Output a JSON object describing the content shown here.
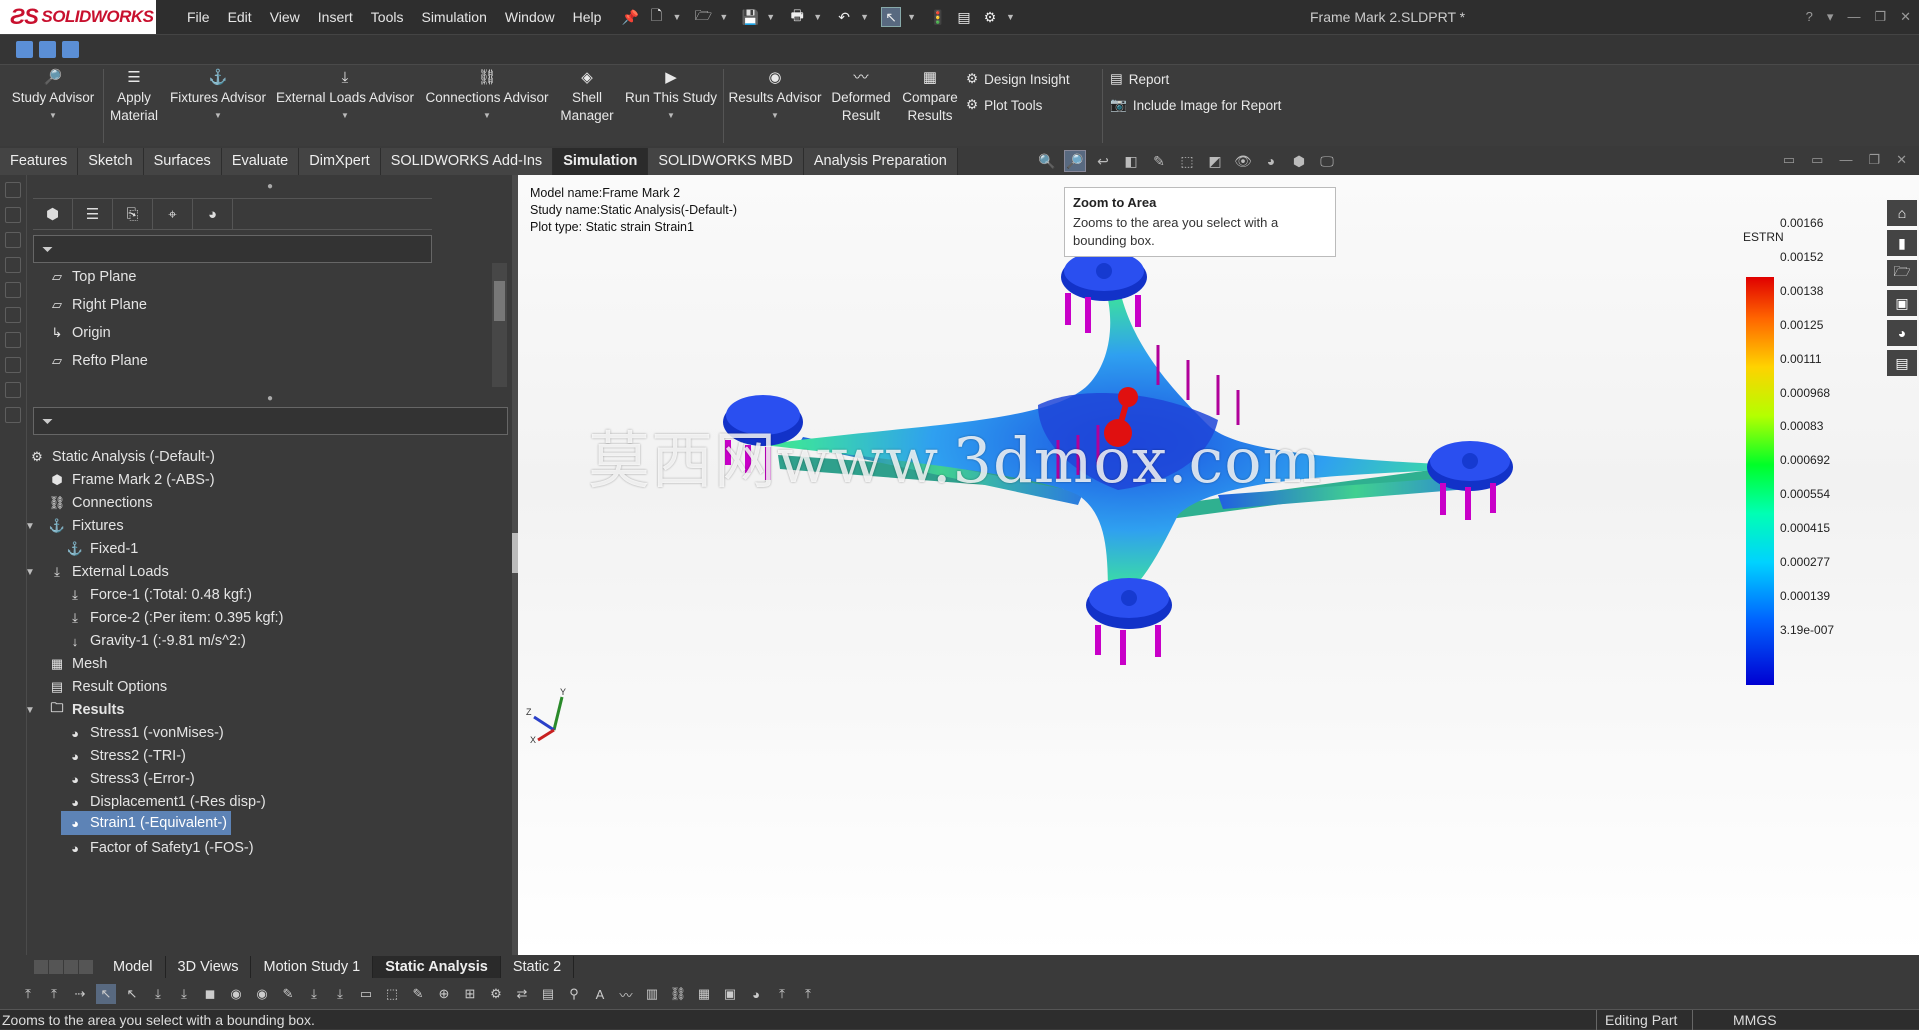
{
  "app": {
    "logo": "SOLIDWORKS",
    "doc_title": "Frame Mark 2.SLDPRT *"
  },
  "menu": [
    "File",
    "Edit",
    "View",
    "Insert",
    "Tools",
    "Simulation",
    "Window",
    "Help"
  ],
  "ribbon": {
    "study_advisor": "Study Advisor",
    "apply_material": [
      "Apply",
      "Material"
    ],
    "fixtures_advisor": "Fixtures Advisor",
    "external_loads_advisor": "External Loads Advisor",
    "connections_advisor": "Connections Advisor",
    "shell_manager": [
      "Shell",
      "Manager"
    ],
    "run_this_study": "Run This Study",
    "results_advisor": "Results Advisor",
    "deformed_result": [
      "Deformed",
      "Result"
    ],
    "compare_results": [
      "Compare",
      "Results"
    ],
    "design_insight": "Design Insight",
    "plot_tools": "Plot Tools",
    "report": "Report",
    "include_image": "Include Image for Report"
  },
  "tabs": [
    "Features",
    "Sketch",
    "Surfaces",
    "Evaluate",
    "DimXpert",
    "SOLIDWORKS Add-Ins",
    "Simulation",
    "SOLIDWORKS MBD",
    "Analysis Preparation"
  ],
  "active_tab": "Simulation",
  "feature_tree": [
    "Top Plane",
    "Right Plane",
    "Origin",
    "Refto Plane"
  ],
  "sim_tree": {
    "study": "Static Analysis (-Default-)",
    "part": "Frame Mark 2 (-ABS-)",
    "connections": "Connections",
    "fixtures": "Fixtures",
    "fixed1": "Fixed-1",
    "external_loads": "External Loads",
    "force1": "Force-1 (:Total: 0.48 kgf:)",
    "force2": "Force-2 (:Per item: 0.395 kgf:)",
    "gravity1": "Gravity-1 (:-9.81 m/s^2:)",
    "mesh": "Mesh",
    "result_options": "Result Options",
    "results": "Results",
    "stress1": "Stress1 (-vonMises-)",
    "stress2": "Stress2 (-TRI-)",
    "stress3": "Stress3 (-Error-)",
    "displacement1": "Displacement1 (-Res disp-)",
    "strain1": "Strain1 (-Equivalent-)",
    "fos1": "Factor of Safety1 (-FOS-)"
  },
  "viewport": {
    "model_name": "Model name:Frame Mark 2",
    "study_name": "Study name:Static Analysis(-Default-)",
    "plot_type": "Plot type: Static strain Strain1",
    "tooltip_title": "Zoom to Area",
    "tooltip_body": "Zooms to the area you select with a bounding box.",
    "watermark": "莫西网www.3dmox.com",
    "legend_title": "ESTRN",
    "legend_values": [
      "0.00166",
      "0.00152",
      "0.00138",
      "0.00125",
      "0.00111",
      "0.000968",
      "0.00083",
      "0.000692",
      "0.000554",
      "0.000415",
      "0.000277",
      "0.000139",
      "3.19e-007"
    ]
  },
  "bottom_tabs": [
    "Model",
    "3D Views",
    "Motion Study 1",
    "Static Analysis",
    "Static 2"
  ],
  "active_bottom_tab": "Static Analysis",
  "status": {
    "message": "Zooms to the area you select with a bounding box.",
    "mode": "Editing Part",
    "units": "MMGS"
  },
  "colors": {
    "selection": "#5d83b6",
    "brand": "#c8102e"
  }
}
